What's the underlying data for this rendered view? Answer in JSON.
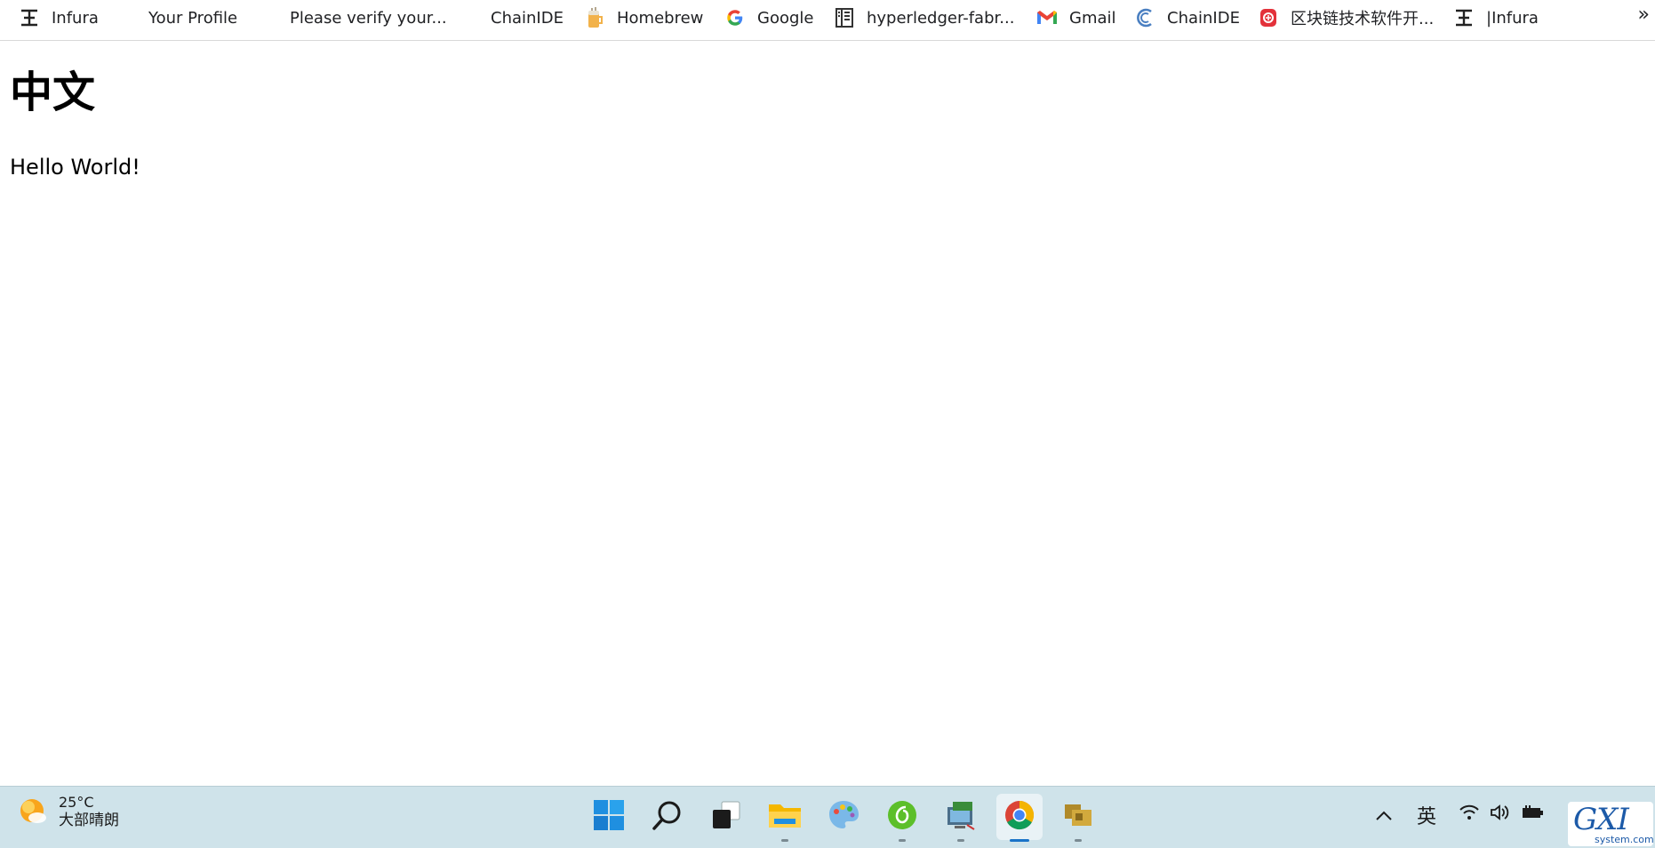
{
  "bookmarks": [
    {
      "label": "Infura",
      "icon": "infura-icon"
    },
    {
      "label": "Your Profile",
      "icon": ""
    },
    {
      "label": "Please verify your...",
      "icon": ""
    },
    {
      "label": "ChainIDE",
      "icon": ""
    },
    {
      "label": "Homebrew",
      "icon": "homebrew-icon"
    },
    {
      "label": "Google",
      "icon": "google-icon"
    },
    {
      "label": "hyperledger-fabr...",
      "icon": "book-icon"
    },
    {
      "label": "Gmail",
      "icon": "gmail-icon"
    },
    {
      "label": "ChainIDE",
      "icon": "chainide-icon"
    },
    {
      "label": "区块链技术软件开...",
      "icon": "red-shield-icon"
    },
    {
      "label": "|Infura",
      "icon": "infura-icon"
    }
  ],
  "bookmarks_overflow": "»",
  "page": {
    "heading": "中文",
    "text": "Hello World!"
  },
  "taskbar": {
    "weather": {
      "temp": "25°C",
      "desc": "大部晴朗"
    },
    "apps": [
      {
        "name": "windows-start-icon"
      },
      {
        "name": "search-icon"
      },
      {
        "name": "task-view-icon"
      },
      {
        "name": "file-explorer-icon"
      },
      {
        "name": "paint-icon"
      },
      {
        "name": "green-app-icon"
      },
      {
        "name": "remote-desktop-icon"
      },
      {
        "name": "chrome-icon",
        "active": true
      },
      {
        "name": "folders-icon"
      }
    ],
    "tray": {
      "chevron": "^",
      "ime": "英"
    }
  },
  "watermark": {
    "main": "GXI网",
    "sub": "system.com"
  },
  "colors": {
    "taskbar_bg": "#cfe3ea",
    "accent": "#1a73c8"
  }
}
